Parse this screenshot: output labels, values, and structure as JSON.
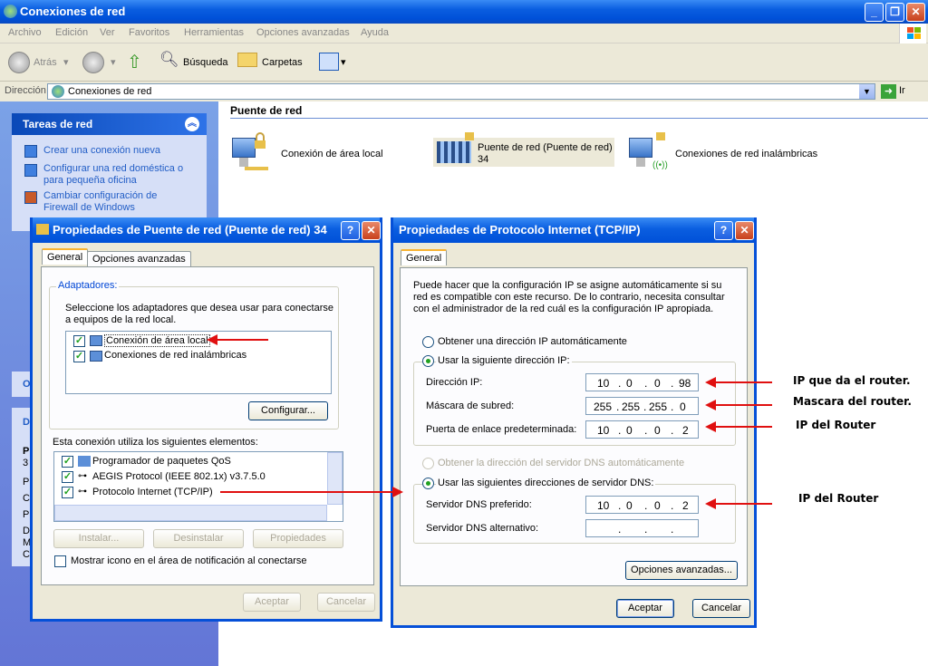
{
  "main_window": {
    "title": "Conexiones de red",
    "menu": [
      "Archivo",
      "Edición",
      "Ver",
      "Favoritos",
      "Herramientas",
      "Opciones avanzadas",
      "Ayuda"
    ],
    "toolbar": {
      "back": "Atrás",
      "search": "Búsqueda",
      "folders": "Carpetas"
    },
    "address": {
      "label": "Dirección",
      "value": "Conexiones de red",
      "go": "Ir"
    }
  },
  "left_panel": {
    "section_title": "Tareas de red",
    "tasks": [
      "Crear una conexión nueva",
      "Configurar una red doméstica o para pequeña oficina",
      "Cambiar configuración de Firewall de Windows"
    ],
    "partial_labels": [
      "O",
      "D",
      "P",
      "3",
      "P",
      "C",
      "P",
      "D",
      "M",
      "C"
    ]
  },
  "content": {
    "group_title": "Puente de red",
    "connections": [
      {
        "name": "Conexión de área local"
      },
      {
        "name": "Puente de red (Puente de red)",
        "sub": "34"
      },
      {
        "name": "Conexiones de red inalámbricas"
      }
    ]
  },
  "bridge_dialog": {
    "title": "Propiedades de Puente de red (Puente de red) 34",
    "tabs": [
      "General",
      "Opciones avanzadas"
    ],
    "adapters_group": "Adaptadores:",
    "adapters_desc": "Seleccione los adaptadores que desea usar para conectarse a equipos de la red local.",
    "adapters": [
      {
        "label": "Conexión de área local",
        "checked": true
      },
      {
        "label": "Conexiones de red inalámbricas",
        "checked": true
      }
    ],
    "configure_button": "Configurar...",
    "elements_label": "Esta conexión utiliza los siguientes elementos:",
    "elements": [
      {
        "label": "Programador de paquetes QoS",
        "checked": true
      },
      {
        "label": "AEGIS Protocol (IEEE 802.1x) v3.7.5.0",
        "checked": true
      },
      {
        "label": "Protocolo Internet (TCP/IP)",
        "checked": true
      }
    ],
    "install_button": "Instalar...",
    "uninstall_button": "Desinstalar",
    "properties_button": "Propiedades",
    "show_icon_label": "Mostrar icono en el área de notificación al conectarse",
    "ok_button": "Aceptar",
    "cancel_button": "Cancelar"
  },
  "tcpip_dialog": {
    "title": "Propiedades de Protocolo Internet (TCP/IP)",
    "tab": "General",
    "description": "Puede hacer que la configuración IP se asigne automáticamente si su red es compatible con este recurso. De lo contrario, necesita consultar con el administrador de la red cuál es la configuración IP apropiada.",
    "auto_ip": "Obtener una dirección IP automáticamente",
    "manual_ip": "Usar la siguiente dirección IP:",
    "ip_label": "Dirección IP:",
    "ip": [
      "10",
      "0",
      "0",
      "98"
    ],
    "mask_label": "Máscara de subred:",
    "mask": [
      "255",
      "255",
      "255",
      "0"
    ],
    "gateway_label": "Puerta de enlace predeterminada:",
    "gateway": [
      "10",
      "0",
      "0",
      "2"
    ],
    "auto_dns": "Obtener la dirección del servidor DNS automáticamente",
    "manual_dns": "Usar las siguientes direcciones de servidor DNS:",
    "dns1_label": "Servidor DNS preferido:",
    "dns1": [
      "10",
      "0",
      "0",
      "2"
    ],
    "dns2_label": "Servidor DNS alternativo:",
    "advanced_button": "Opciones avanzadas...",
    "ok_button": "Aceptar",
    "cancel_button": "Cancelar"
  },
  "annotations": {
    "ip_note": "IP que da el router.",
    "mask_note": "Mascara del router.",
    "gateway_note": "IP del Router",
    "dns_note": "IP del Router"
  },
  "colors": {
    "xp_blue": "#0a5ee0",
    "annotation_red": "#e01010"
  }
}
